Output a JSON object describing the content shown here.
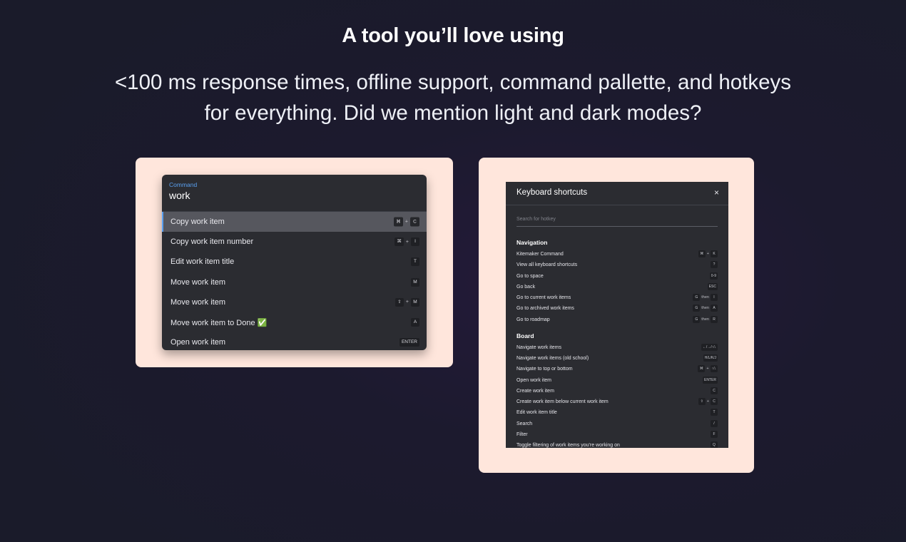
{
  "hero": {
    "heading": "A tool you’ll love using",
    "subheading": "<100 ms response times, offline support, command pallette, and hotkeys for everything. Did we mention light and dark modes?"
  },
  "command_palette": {
    "label": "Command",
    "query": "work",
    "items": [
      {
        "label": "Copy work item",
        "keys": [
          "⌘",
          "+",
          "C"
        ],
        "active": true
      },
      {
        "label": "Copy work item number",
        "keys": [
          "⌘",
          "+",
          "I"
        ]
      },
      {
        "label": "Edit work item title",
        "keys": [
          "T"
        ]
      },
      {
        "label": "Move work item",
        "keys": [
          "M"
        ]
      },
      {
        "label": "Move work item",
        "keys": [
          "⇧",
          "+",
          "M"
        ]
      },
      {
        "label": "Move work item to Done ✅",
        "keys": [
          "A"
        ]
      },
      {
        "label": "Open work item",
        "keys": [
          "ENTER"
        ]
      }
    ]
  },
  "shortcuts_modal": {
    "title": "Keyboard shortcuts",
    "close": "×",
    "search_placeholder": "Search for hotkey",
    "sections": [
      {
        "title": "Navigation",
        "rows": [
          {
            "label": "Kitemaker Command",
            "keys": [
              "⌘",
              "+",
              "K"
            ]
          },
          {
            "label": "View all keyboard shortcuts",
            "keys": [
              "?"
            ]
          },
          {
            "label": "Go to space",
            "keys": [
              "0-9"
            ]
          },
          {
            "label": "Go back",
            "keys": [
              "ESC"
            ]
          },
          {
            "label": "Go to current work items",
            "keys": [
              "G",
              "then",
              "I"
            ]
          },
          {
            "label": "Go to archived work items",
            "keys": [
              "G",
              "then",
              "A"
            ]
          },
          {
            "label": "Go to roadmap",
            "keys": [
              "G",
              "then",
              "R"
            ]
          }
        ]
      },
      {
        "title": "Board",
        "rows": [
          {
            "label": "Navigate work items",
            "keys": [
              "←/→/↑/↓"
            ]
          },
          {
            "label": "Navigate work items (old school)",
            "keys": [
              "H/L/K/J"
            ]
          },
          {
            "label": "Navigate to top or bottom",
            "keys": [
              "⌘",
              "+",
              "↑/↓"
            ]
          },
          {
            "label": "Open work item",
            "keys": [
              "ENTER"
            ]
          },
          {
            "label": "Create work item",
            "keys": [
              "C"
            ]
          },
          {
            "label": "Create work item below current work item",
            "keys": [
              "⇧",
              "+",
              "C"
            ]
          },
          {
            "label": "Edit work item title",
            "keys": [
              "T"
            ]
          },
          {
            "label": "Search",
            "keys": [
              "/"
            ]
          },
          {
            "label": "Filter",
            "keys": [
              "F"
            ]
          },
          {
            "label": "Toggle filtering of work items you're working on",
            "keys": [
              "Q"
            ]
          }
        ]
      }
    ]
  }
}
